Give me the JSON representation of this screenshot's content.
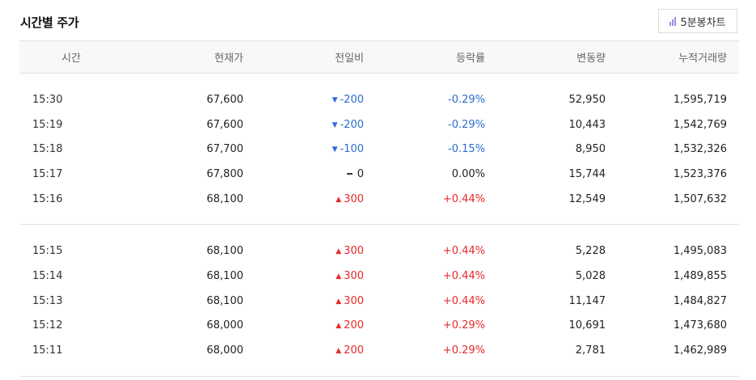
{
  "section": {
    "title": "시간별 주가"
  },
  "chart_button": {
    "label": "5분봉차트",
    "icon": "bar-chart-icon",
    "icon_color": "#a48be0"
  },
  "colors": {
    "up": "#e8282b",
    "down": "#2c6ccf"
  },
  "columns": [
    "시간",
    "현재가",
    "전일비",
    "등락률",
    "변동량",
    "누적거래량"
  ],
  "groups": [
    {
      "rows": [
        {
          "time": "15:30",
          "price": "67,600",
          "dir": "down",
          "change": "-200",
          "rate": "-0.29%",
          "volume": "52,950",
          "cumulative": "1,595,719"
        },
        {
          "time": "15:19",
          "price": "67,600",
          "dir": "down",
          "change": "-200",
          "rate": "-0.29%",
          "volume": "10,443",
          "cumulative": "1,542,769"
        },
        {
          "time": "15:18",
          "price": "67,700",
          "dir": "down",
          "change": "-100",
          "rate": "-0.15%",
          "volume": "8,950",
          "cumulative": "1,532,326"
        },
        {
          "time": "15:17",
          "price": "67,800",
          "dir": "flat",
          "change": "0",
          "rate": "0.00%",
          "volume": "15,744",
          "cumulative": "1,523,376"
        },
        {
          "time": "15:16",
          "price": "68,100",
          "dir": "up",
          "change": "300",
          "rate": "+0.44%",
          "volume": "12,549",
          "cumulative": "1,507,632"
        }
      ]
    },
    {
      "rows": [
        {
          "time": "15:15",
          "price": "68,100",
          "dir": "up",
          "change": "300",
          "rate": "+0.44%",
          "volume": "5,228",
          "cumulative": "1,495,083"
        },
        {
          "time": "15:14",
          "price": "68,100",
          "dir": "up",
          "change": "300",
          "rate": "+0.44%",
          "volume": "5,028",
          "cumulative": "1,489,855"
        },
        {
          "time": "15:13",
          "price": "68,100",
          "dir": "up",
          "change": "300",
          "rate": "+0.44%",
          "volume": "11,147",
          "cumulative": "1,484,827"
        },
        {
          "time": "15:12",
          "price": "68,000",
          "dir": "up",
          "change": "200",
          "rate": "+0.29%",
          "volume": "10,691",
          "cumulative": "1,473,680"
        },
        {
          "time": "15:11",
          "price": "68,000",
          "dir": "up",
          "change": "200",
          "rate": "+0.29%",
          "volume": "2,781",
          "cumulative": "1,462,989"
        }
      ]
    }
  ]
}
